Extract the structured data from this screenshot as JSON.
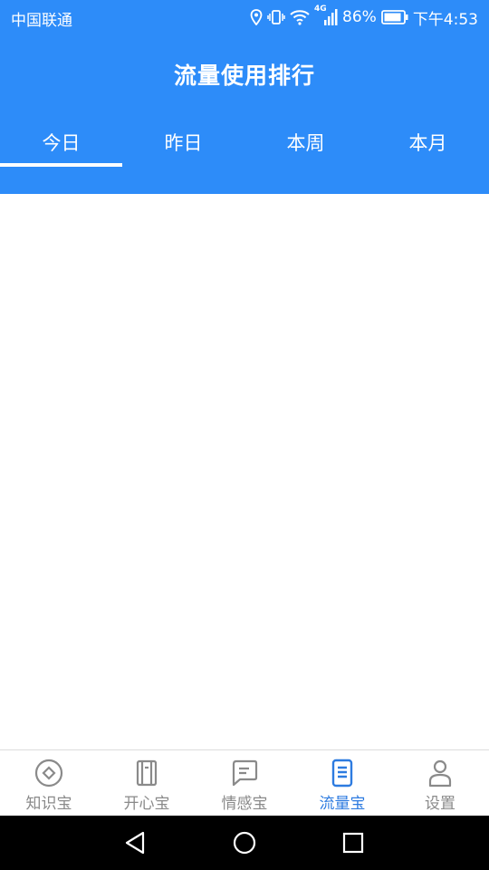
{
  "status_bar": {
    "carrier": "中国联通",
    "network_type": "4G",
    "battery": "86%",
    "time": "下午4:53",
    "icons": [
      "location-icon",
      "vibrate-icon",
      "wifi-icon",
      "signal-icon",
      "battery-icon"
    ]
  },
  "header": {
    "title": "流量使用排行",
    "background_color": "#2d8cf9"
  },
  "tabs": [
    {
      "label": "今日",
      "active": true
    },
    {
      "label": "昨日",
      "active": false
    },
    {
      "label": "本周",
      "active": false
    },
    {
      "label": "本月",
      "active": false
    }
  ],
  "bottom_nav": {
    "active_color": "#2d7be0",
    "items": [
      {
        "label": "知识宝",
        "icon": "compass-icon",
        "active": false
      },
      {
        "label": "开心宝",
        "icon": "notebook-icon",
        "active": false
      },
      {
        "label": "情感宝",
        "icon": "message-icon",
        "active": false
      },
      {
        "label": "流量宝",
        "icon": "document-icon",
        "active": true
      },
      {
        "label": "设置",
        "icon": "user-icon",
        "active": false
      }
    ]
  },
  "system_nav": [
    "back-icon",
    "home-icon",
    "recents-icon"
  ]
}
